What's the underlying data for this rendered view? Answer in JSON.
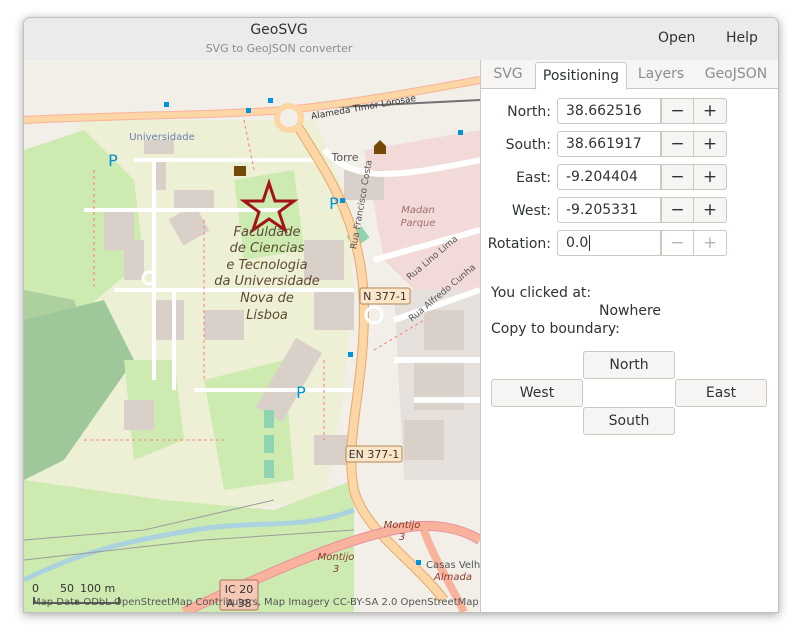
{
  "window": {
    "title": "GeoSVG",
    "subtitle": "SVG to GeoJSON converter"
  },
  "header": {
    "open_label": "Open",
    "help_label": "Help"
  },
  "tabs": [
    {
      "label": "SVG",
      "active": false
    },
    {
      "label": "Positioning",
      "active": true
    },
    {
      "label": "Layers",
      "active": false
    },
    {
      "label": "GeoJSON",
      "active": false
    }
  ],
  "positioning": {
    "north": {
      "label": "North:",
      "value": "38.662516"
    },
    "south": {
      "label": "South:",
      "value": "38.661917"
    },
    "east": {
      "label": "East:",
      "value": "-9.204404"
    },
    "west": {
      "label": "West:",
      "value": "-9.205331"
    },
    "rotation": {
      "label": "Rotation:",
      "value": "0.0"
    },
    "minus": "−",
    "plus": "+"
  },
  "click_info": {
    "label": "You clicked at:",
    "value": "Nowhere"
  },
  "copy_boundary": {
    "label": "Copy to boundary:",
    "north": "North",
    "west": "West",
    "east": "East",
    "south": "South"
  },
  "map": {
    "labels": {
      "university": "Universidade",
      "faculty": [
        "Faculdade",
        "de Ciencias",
        "e Tecnologia",
        "da Universidade",
        "Nova de",
        "Lisboa"
      ],
      "torre": "Torre",
      "rua_francisco_costa": "Rua Francisco Costa",
      "alameda": "Alameda Timor Lorosae",
      "madan": [
        "Madan",
        "Parque"
      ],
      "rua_lino_lima": "Rua Lino Lima",
      "rua_alfredo_cunha": "Rua Alfredo Cunha",
      "n377": "N 377-1",
      "en377": "EN 377-1",
      "montijo1": "Montijo",
      "montijo1_num": "3",
      "montijo2": "Montijo",
      "montijo2_num": "3",
      "casas": "Casas Velh",
      "almada": "Almada",
      "ic20": "IC 20",
      "a38": "A 38",
      "parking": "P",
      "scale": [
        "0",
        "50",
        "100 m"
      ],
      "attribution": "Map Data ODbL OpenStreetMap Contributors, Map Imagery CC-BY-SA 2.0 OpenStreetMap"
    },
    "colors": {
      "land": "#f2efe9",
      "campus": "#eef0d5",
      "grass": "#cdebb0",
      "wood": "#add19e",
      "building": "#d9d0c9",
      "trunk": "#f9b29c",
      "primary": "#fcd6a4",
      "star": "#a31515"
    }
  }
}
